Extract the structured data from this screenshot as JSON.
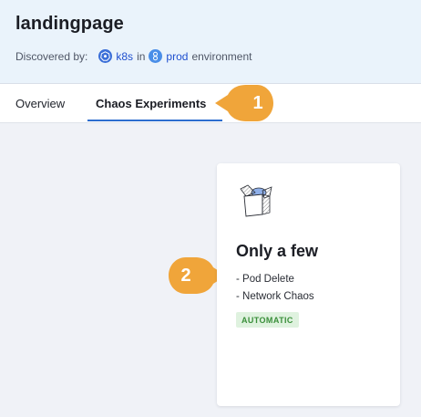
{
  "header": {
    "title": "landingpage",
    "discovered_label": "Discovered by:",
    "source": "k8s",
    "in_text": "in",
    "environment": "prod",
    "environment_suffix": "environment"
  },
  "tabs": [
    {
      "label": "Overview",
      "active": false
    },
    {
      "label": "Chaos Experiments",
      "active": true
    }
  ],
  "callouts": [
    "1",
    "2"
  ],
  "card": {
    "icon": "open-box-icon",
    "title": "Only a few",
    "faults": [
      "- Pod Delete",
      "- Network Chaos"
    ],
    "badge": "AUTOMATIC"
  },
  "colors": {
    "accent": "#2e6ecf",
    "callout": "#f0a53a",
    "badge_bg": "#dff2df",
    "badge_text": "#3a8f3a"
  }
}
